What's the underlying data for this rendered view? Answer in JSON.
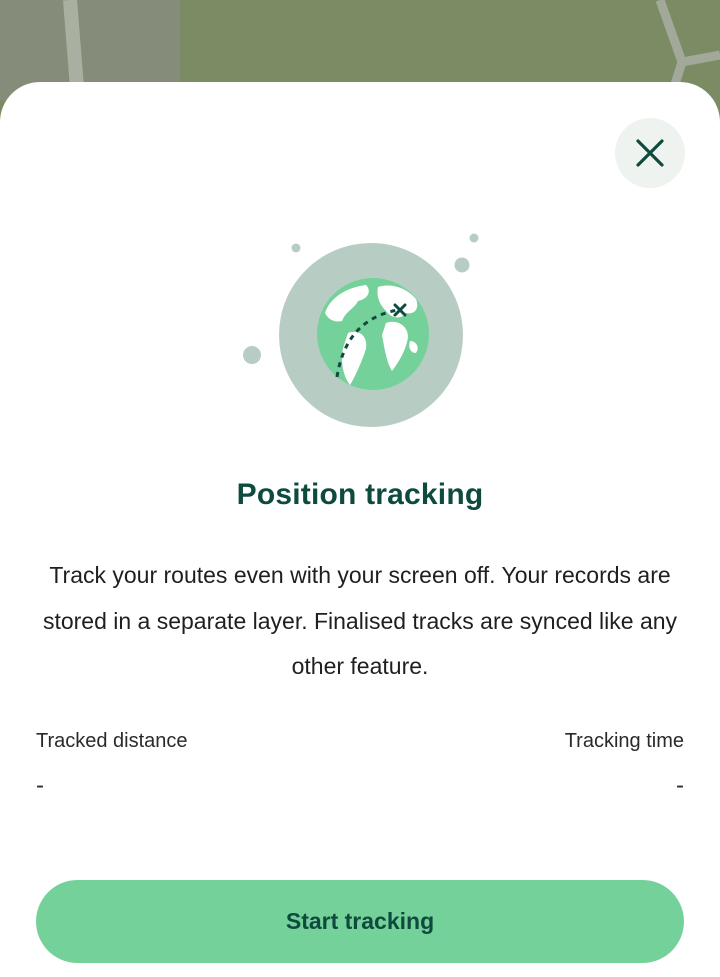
{
  "colors": {
    "accent": "#74d19a",
    "title": "#0f4a3f",
    "close_bg": "#eef3f0",
    "globe_ring": "#b7cdc4"
  },
  "close_button": {
    "icon": "close-icon"
  },
  "illustration": {
    "icon": "globe-route-icon"
  },
  "title": "Position tracking",
  "description": "Track your routes even with your screen off. Your records are stored in a separate layer. Finalised tracks are synced like any other feature.",
  "stats": {
    "distance_label": "Tracked distance",
    "distance_value": "-",
    "time_label": "Tracking time",
    "time_value": "-"
  },
  "start_button_label": "Start tracking"
}
